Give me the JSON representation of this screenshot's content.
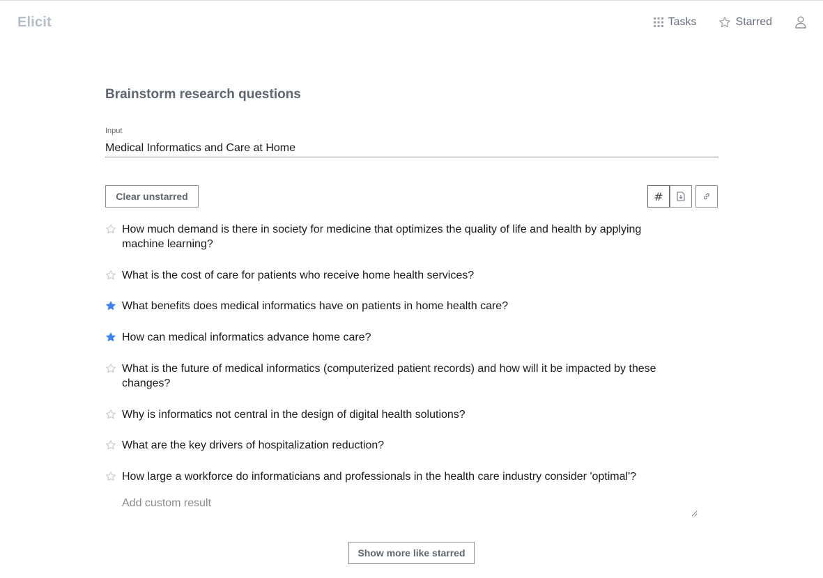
{
  "header": {
    "logo": "Elicit",
    "nav": {
      "tasks_label": "Tasks",
      "starred_label": "Starred"
    }
  },
  "main": {
    "title": "Brainstorm research questions",
    "input": {
      "label": "Input",
      "value": "Medical Informatics and Care at Home"
    },
    "clear_button": "Clear unstarred",
    "hash_button": "#",
    "results": [
      {
        "text": "How much demand is there in society for medicine that optimizes the quality of life and health by applying machine learning?",
        "starred": false
      },
      {
        "text": "What is the cost of care for patients who receive home health services?",
        "starred": false
      },
      {
        "text": "What benefits does medical informatics have on patients in home health care?",
        "starred": true
      },
      {
        "text": "How can medical informatics advance home care?",
        "starred": true
      },
      {
        "text": "What is the future of medical informatics (computerized patient records) and how will it be impacted by these changes?",
        "starred": false
      },
      {
        "text": "Why is informatics not central in the design of digital health solutions?",
        "starred": false
      },
      {
        "text": "What are the key drivers of hospitalization reduction?",
        "starred": false
      },
      {
        "text": "How large a workforce do informaticians and professionals in the health care industry consider 'optimal'?",
        "starred": false
      }
    ],
    "custom_placeholder": "Add custom result",
    "show_more_button": "Show more like starred"
  },
  "colors": {
    "star_filled": "#3b82f6",
    "star_empty": "#c4c9d0",
    "logo": "#b4bcc8"
  }
}
